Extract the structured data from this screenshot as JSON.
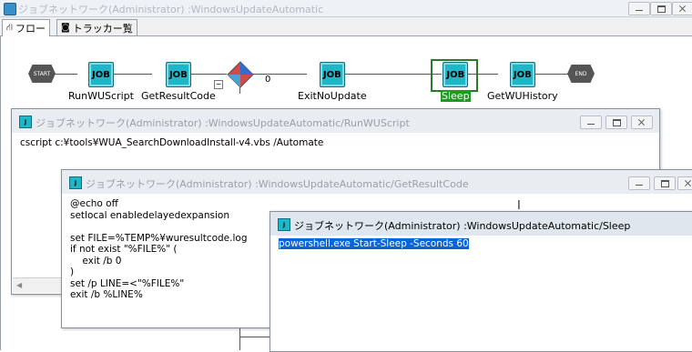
{
  "main_window": {
    "title": "ジョブネットワーク(Administrator) :WindowsUpdateAutomatic"
  },
  "tabs": [
    {
      "label": "フロー",
      "icon": "flow-icon"
    },
    {
      "label": "トラッカー覧",
      "icon": "tracker-icon"
    }
  ],
  "flow": {
    "start_label": "START",
    "end_label": "END",
    "job_icon_text": "JOB",
    "branch_label": "0",
    "collapse_label": "−",
    "jobs": [
      {
        "name": "RunWUScript"
      },
      {
        "name": "GetResultCode"
      },
      {
        "name": "ExitNoUpdate"
      },
      {
        "name": "Sleep",
        "selected": true
      },
      {
        "name": "GetWUHistory"
      }
    ]
  },
  "windows": {
    "run_wu_script": {
      "title": "ジョブネットワーク(Administrator) :WindowsUpdateAutomatic/RunWUScript",
      "content": "cscript c:¥tools¥WUA_SearchDownloadInstall-v4.vbs /Automate"
    },
    "get_result_code": {
      "title": "ジョブネットワーク(Administrator) :WindowsUpdateAutomatic/GetResultCode",
      "content": "@echo off\nsetlocal enabledelayedexpansion\n\nset FILE=%TEMP%¥wuresultcode.log\nif not exist \"%FILE%\" (\n    exit /b 0\n)\nset /p LINE=<\"%FILE%\"\nexit /b %LINE%"
    },
    "sleep": {
      "title": "ジョブネットワーク(Administrator) :WindowsUpdateAutomatic/Sleep",
      "content": "powershell.exe Start-Sleep -Seconds 60"
    }
  },
  "colors": {
    "job_icon": "#1fb6c8",
    "selection": "#0a64d6",
    "selected_label": "#1e9b22"
  }
}
